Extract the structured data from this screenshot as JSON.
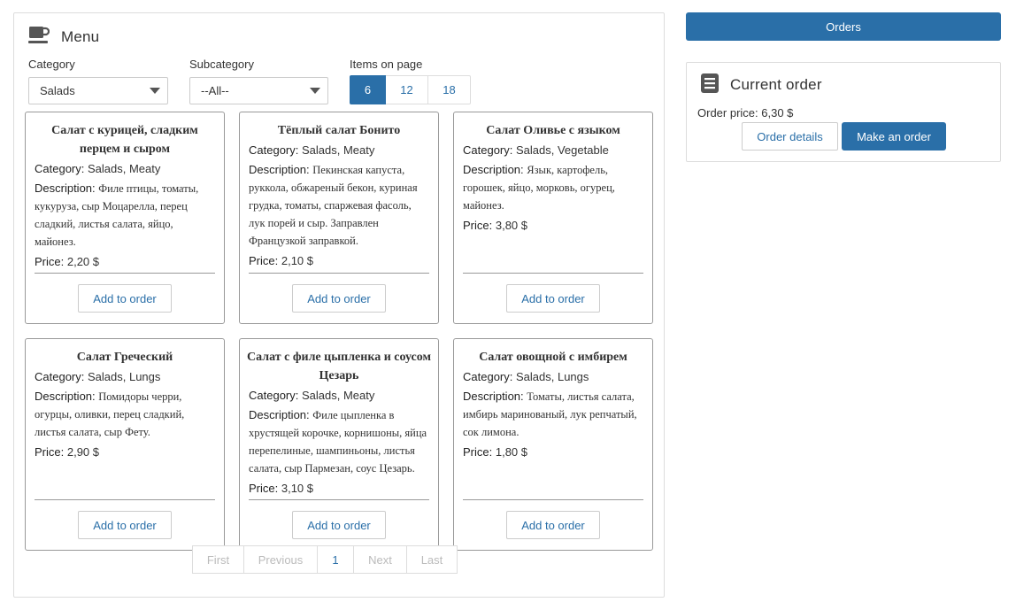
{
  "menu": {
    "title": "Menu",
    "icon": "coffee-cup-icon",
    "filters": {
      "category_label": "Category",
      "category_value": "Salads",
      "subcategory_label": "Subcategory",
      "subcategory_value": "--All--",
      "items_label": "Items on page",
      "page_sizes": [
        "6",
        "12",
        "18"
      ],
      "selected_page_size": "6"
    },
    "labels": {
      "category": "Category:",
      "description": "Description:",
      "price": "Price:",
      "add": "Add to order"
    },
    "items": [
      {
        "name": "Салат с курицей, сладким перцем и сыром",
        "category": "Salads, Meaty",
        "description": "Филе птицы, томаты, кукуруза, сыр Моцарелла, перец сладкий, листья салата, яйцо, майонез.",
        "price": "2,20 $"
      },
      {
        "name": "Тёплый салат Бонито",
        "category": "Salads, Meaty",
        "description": "Пекинская капуста, руккола, обжареный бекон, куриная грудка, томаты, спаржевая фасоль, лук порей и сыр. Заправлен Французкой заправкой.",
        "price": "2,10 $"
      },
      {
        "name": "Салат Оливье с языком",
        "category": "Salads, Vegetable",
        "description": "Язык, картофель, горошек, яйцо, морковь, огурец, майонез.",
        "price": "3,80 $"
      },
      {
        "name": "Салат Греческий",
        "category": "Salads, Lungs",
        "description": "Помидоры черри, огурцы, оливки, перец сладкий, листья салата, сыр Фету.",
        "price": "2,90 $"
      },
      {
        "name": "Салат с филе цыпленка и соусом Цезарь",
        "category": "Salads, Meaty",
        "description": "Филе цыпленка в хрустящей корочке, корнишоны, яйца перепелиные, шампиньоны, листья салата, сыр Пармезан, соус Цезарь.",
        "price": "3,10 $"
      },
      {
        "name": "Салат овощной с имбирем",
        "category": "Salads, Lungs",
        "description": "Томаты, листья салата, имбирь маринованый, лук репчатый, сок лимона.",
        "price": "1,80 $"
      }
    ],
    "pagination": [
      "First",
      "Previous",
      "1",
      "Next",
      "Last"
    ],
    "current_page": "1"
  },
  "orders_button": "Orders",
  "current_order": {
    "title": "Current order",
    "icon": "document-icon",
    "price_label": "Order price:",
    "price_value": "6,30 $",
    "details_button": "Order details",
    "make_button": "Make an order"
  },
  "colors": {
    "accent": "#2a6fa8",
    "border": "#dddddd",
    "card_border": "#999999",
    "disabled_text": "#bbbbbb"
  }
}
